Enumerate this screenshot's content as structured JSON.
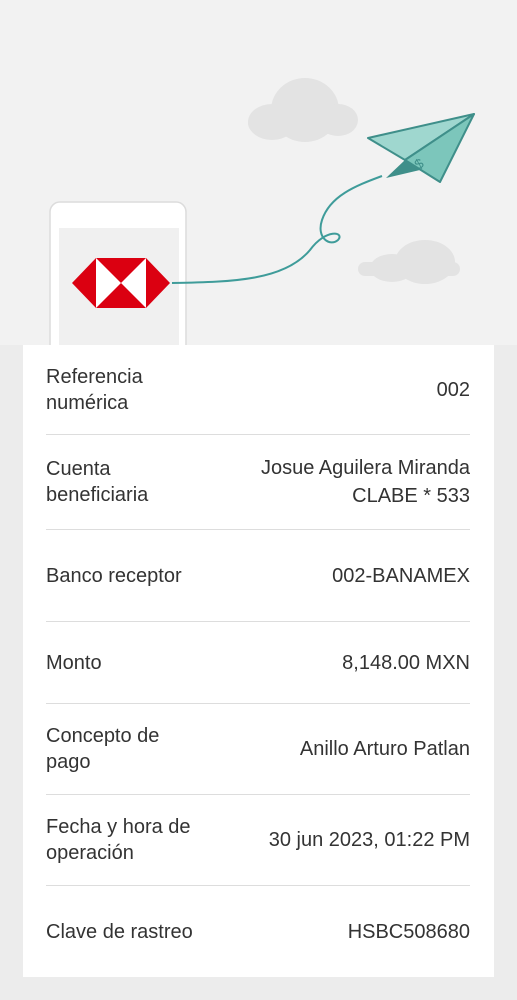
{
  "header": {
    "illustration_icons": [
      "hsbc-logo-icon",
      "paper-plane-icon",
      "cloud-icon"
    ],
    "brand_color": "#db0011"
  },
  "details": [
    {
      "label": "Referencia numérica",
      "value": "002"
    },
    {
      "label": "Cuenta beneficiaria",
      "value": "Josue Aguilera Miranda\nCLABE * 533"
    },
    {
      "label": "Banco receptor",
      "value": "002-BANAMEX"
    },
    {
      "label": "Monto",
      "value": "8,148.00 MXN"
    },
    {
      "label": "Concepto de pago",
      "value": "Anillo Arturo Patlan"
    },
    {
      "label": "Fecha y hora de operación",
      "value": "30 jun 2023, 01:22 PM"
    },
    {
      "label": "Clave de rastreo",
      "value": "HSBC508680"
    }
  ]
}
